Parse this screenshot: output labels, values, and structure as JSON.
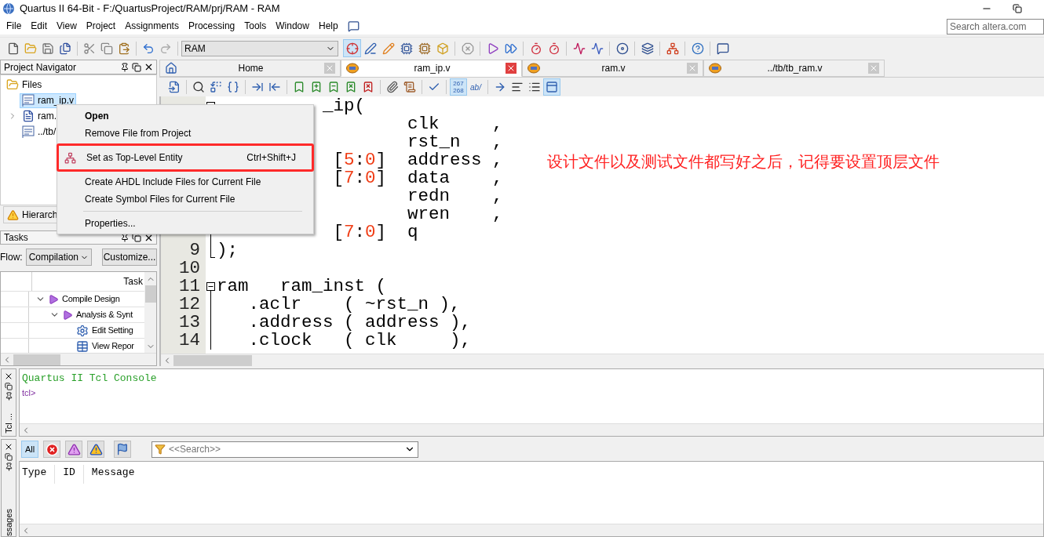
{
  "window": {
    "title": "Quartus II 64-Bit - F:/QuartusProject/RAM/prj/RAM - RAM"
  },
  "menu": [
    "File",
    "Edit",
    "View",
    "Project",
    "Assignments",
    "Processing",
    "Tools",
    "Window",
    "Help"
  ],
  "search": {
    "placeholder": "Search altera.com"
  },
  "toolbar": {
    "project": "RAM",
    "tools": [
      {
        "selected": true
      },
      {
        "selected": false
      },
      {
        "selected": false
      },
      {
        "selected": false
      },
      {
        "selected": false
      },
      {
        "selected": false
      },
      {
        "selected": false
      },
      {
        "selected": false
      },
      {
        "selected": false
      },
      {
        "selected": false
      },
      {
        "selected": false
      },
      {
        "selected": false
      },
      {
        "selected": false
      },
      {
        "selected": false
      },
      {
        "selected": false
      },
      {
        "selected": false
      },
      {
        "selected": false
      },
      {
        "selected": false
      }
    ]
  },
  "project_navigator": {
    "title": "Project Navigator",
    "tree": [
      {
        "label": "Files",
        "kind": "folder",
        "expanded": true,
        "children": [
          {
            "label": "ram_ip.v",
            "kind": "verilog",
            "selected": true
          },
          {
            "label": "ram.",
            "kind": "document",
            "selected": false,
            "expanded": false
          },
          {
            "label": "../tb/",
            "kind": "verilog",
            "selected": false
          }
        ]
      }
    ],
    "tab": "Hierarch"
  },
  "tasks": {
    "title": "Tasks",
    "flow_label": "Flow:",
    "flow": "Compilation",
    "customize": "Customize...",
    "column": "Task",
    "rows": [
      {
        "label": "Compile Design",
        "kind": "flow",
        "expanded": true,
        "children": [
          {
            "label": "Analysis & Synt",
            "kind": "flow",
            "expanded": true,
            "children": [
              {
                "label": "Edit Setting",
                "kind": "settings"
              },
              {
                "label": "View Repor",
                "kind": "report"
              }
            ]
          }
        ]
      }
    ]
  },
  "editor": {
    "tabs": [
      {
        "label": "Home",
        "kind": "home",
        "selected": false
      },
      {
        "label": "ram_ip.v",
        "kind": "verilog",
        "selected": true
      },
      {
        "label": "ram.v",
        "kind": "verilog",
        "selected": false
      },
      {
        "label": "../tb/tb_ram.v",
        "kind": "verilog",
        "selected": false
      }
    ],
    "tools": [
      {
        "selected": false
      },
      {
        "selected": false
      },
      {
        "selected": false
      },
      {
        "selected": false
      },
      {
        "selected": false
      },
      {
        "selected": false
      },
      {
        "selected": false
      },
      {
        "selected": false
      },
      {
        "selected": false
      },
      {
        "selected": false
      },
      {
        "selected": false
      },
      {
        "selected": false
      },
      {
        "selected": false
      },
      {
        "selected": false
      },
      {
        "selected": true,
        "lines": [
          "267",
          "268"
        ]
      },
      {
        "selected": false,
        "label": "ab/"
      },
      {
        "selected": false
      },
      {
        "selected": false
      },
      {
        "selected": false
      },
      {
        "selected": true
      }
    ],
    "lines": [
      {
        "kind": "block_start",
        "tokens": [
          {
            "text": "          _ip(",
            "kind": "plain"
          }
        ]
      },
      {
        "kind": "block",
        "tokens": [
          {
            "text": "                  clk     ,",
            "kind": "plain"
          }
        ]
      },
      {
        "kind": "block",
        "tokens": [
          {
            "text": "                  rst_n   ,",
            "kind": "plain"
          }
        ]
      },
      {
        "kind": "block",
        "tokens": [
          {
            "text": "           [",
            "kind": "plain"
          },
          {
            "text": "5",
            "kind": "number"
          },
          {
            "text": ":",
            "kind": "plain"
          },
          {
            "text": "0",
            "kind": "number"
          },
          {
            "text": "]  address ,",
            "kind": "plain"
          }
        ]
      },
      {
        "kind": "block",
        "tokens": [
          {
            "text": "           [",
            "kind": "plain"
          },
          {
            "text": "7",
            "kind": "number"
          },
          {
            "text": ":",
            "kind": "plain"
          },
          {
            "text": "0",
            "kind": "number"
          },
          {
            "text": "]  data    ,",
            "kind": "plain"
          }
        ]
      },
      {
        "kind": "block",
        "tokens": [
          {
            "text": "                  redn    ,",
            "kind": "plain"
          }
        ]
      },
      {
        "kind": "block",
        "tokens": [
          {
            "text": "                  wren    ,",
            "kind": "plain"
          }
        ]
      },
      {
        "kind": "block",
        "tokens": [
          {
            "text": "           [",
            "kind": "plain"
          },
          {
            "text": "7",
            "kind": "number"
          },
          {
            "text": ":",
            "kind": "plain"
          },
          {
            "text": "0",
            "kind": "number"
          },
          {
            "text": "]  q",
            "kind": "plain"
          }
        ]
      },
      {
        "number": "9",
        "kind": "block_end",
        "tokens": [
          {
            "text": ");",
            "kind": "plain"
          }
        ]
      },
      {
        "number": "10",
        "kind": "plain"
      },
      {
        "number": "11",
        "kind": "block_start",
        "tokens": [
          {
            "text": "ram   ram_inst (",
            "kind": "plain"
          }
        ]
      },
      {
        "number": "12",
        "kind": "block",
        "tokens": [
          {
            "text": "   .aclr    ( ~rst_n ),",
            "kind": "plain"
          }
        ]
      },
      {
        "number": "13",
        "kind": "block",
        "tokens": [
          {
            "text": "   .address ( address ),",
            "kind": "plain"
          }
        ]
      },
      {
        "number": "14",
        "kind": "block",
        "tokens": [
          {
            "text": "   .clock   ( clk     ),",
            "kind": "plain"
          }
        ]
      }
    ]
  },
  "context_menu": {
    "items": [
      {
        "kind": "item",
        "label": "Open",
        "default": true,
        "annotated": false
      },
      {
        "kind": "item",
        "label": "Remove File from Project",
        "default": false,
        "annotated": false
      },
      {
        "kind": "action",
        "label": "Set as Top-Level Entity",
        "shortcut": "Ctrl+Shift+J",
        "default": false,
        "annotated": true
      },
      {
        "kind": "item",
        "label": "Create AHDL Include Files for Current File",
        "default": false,
        "annotated": false
      },
      {
        "kind": "item",
        "label": "Create Symbol Files for Current File",
        "default": false,
        "annotated": false
      },
      {
        "kind": "separator"
      },
      {
        "kind": "item",
        "label": "Properties...",
        "default": false,
        "annotated": false
      }
    ]
  },
  "annotation": "设计文件以及测试文件都写好之后，记得要设置顶层文件",
  "tcl_console": {
    "label": "Tcl ...",
    "title": "Quartus II Tcl Console",
    "prompt": "tcl>"
  },
  "messages": {
    "label": "ssages",
    "filters": [
      {
        "kind": "all",
        "label": "All",
        "selected": true
      },
      {
        "kind": "error",
        "selected": false
      },
      {
        "kind": "critical",
        "selected": false
      },
      {
        "kind": "warning",
        "selected": false
      },
      {
        "kind": "flag",
        "selected": false
      }
    ],
    "search_placeholder": "<<Search>>",
    "columns": [
      "Type",
      "ID",
      "Message"
    ]
  }
}
